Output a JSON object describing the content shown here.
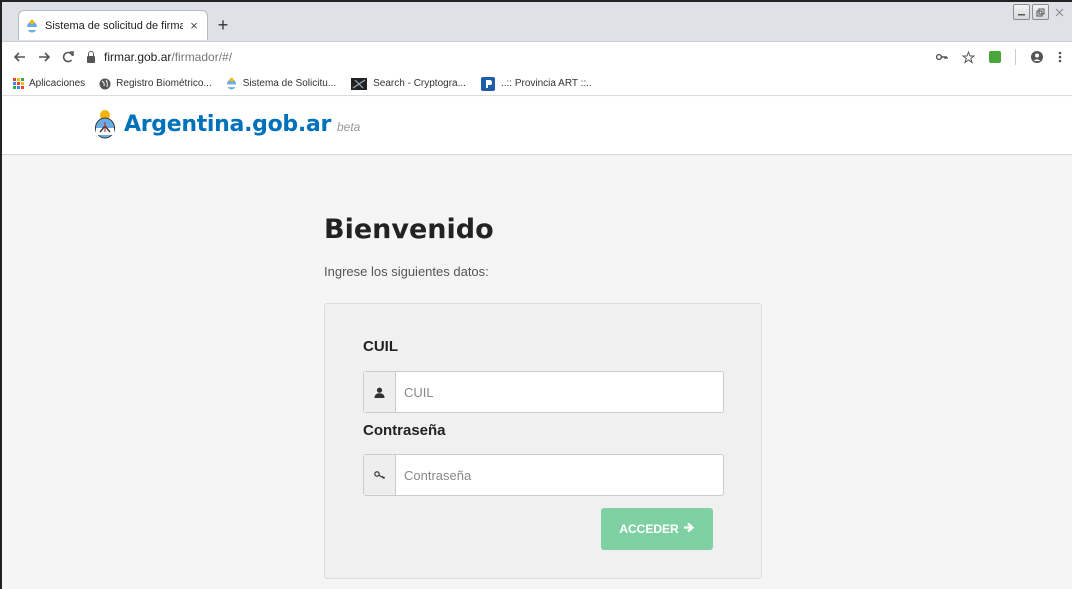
{
  "browser": {
    "tab": {
      "title": "Sistema de solicitud de firma dig",
      "close": "×"
    },
    "new_tab": "+",
    "address": {
      "host": "firmar.gob.ar",
      "path": "/firmador/#/"
    },
    "bookmarks": [
      {
        "label": "Aplicaciones",
        "icon": "apps-grid-icon"
      },
      {
        "label": "Registro Biométrico...",
        "icon": "globe-icon"
      },
      {
        "label": "Sistema de Solicitu...",
        "icon": "argentina-seal-icon"
      },
      {
        "label": "Search - Cryptogra...",
        "icon": "cryptography-icon"
      },
      {
        "label": "..:: Provincia ART ::..",
        "icon": "provincia-art-icon"
      }
    ]
  },
  "site": {
    "brand": "Argentina.gob.ar",
    "beta": "beta",
    "colors": {
      "brand": "#0072bb",
      "button": "#7fd0a3"
    }
  },
  "login": {
    "title": "Bienvenido",
    "subtitle": "Ingrese los siguientes datos:",
    "cuil_label": "CUIL",
    "cuil_placeholder": "CUIL",
    "password_label": "Contraseña",
    "password_placeholder": "Contraseña",
    "submit_label": "ACCEDER"
  }
}
